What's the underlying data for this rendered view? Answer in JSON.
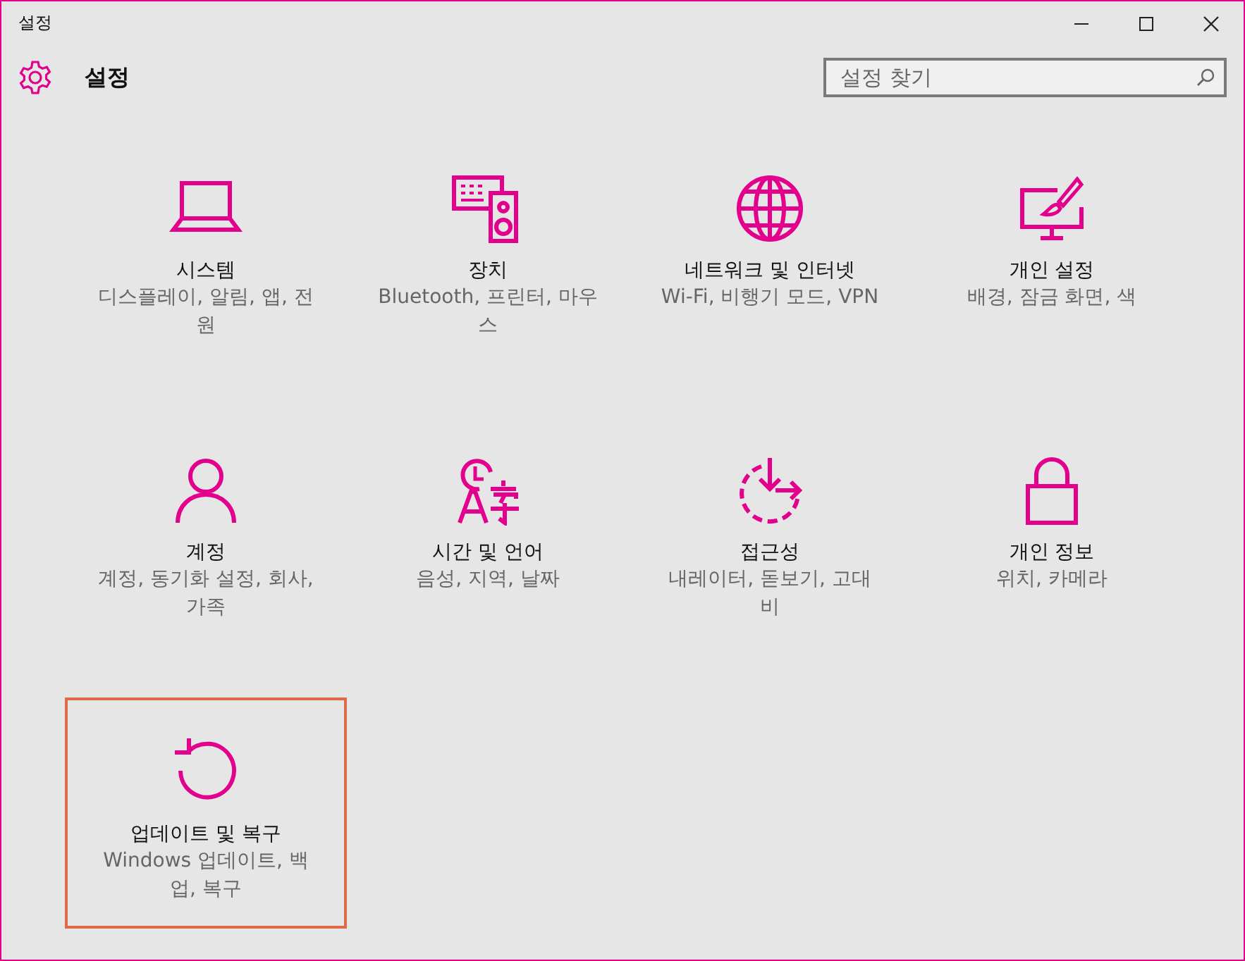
{
  "window": {
    "title": "설정"
  },
  "header": {
    "title": "설정",
    "search": {
      "placeholder": "설정 찾기"
    }
  },
  "tiles": [
    {
      "title": "시스템",
      "description": "디스플레이, 알림, 앱, 전원",
      "selected": false
    },
    {
      "title": "장치",
      "description": "Bluetooth, 프린터, 마우스",
      "selected": false
    },
    {
      "title": "네트워크 및 인터넷",
      "description": "Wi-Fi, 비행기 모드, VPN",
      "selected": false
    },
    {
      "title": "개인 설정",
      "description": "배경, 잠금 화면, 색",
      "selected": false
    },
    {
      "title": "계정",
      "description": "계정, 동기화 설정, 회사, 가족",
      "selected": false
    },
    {
      "title": "시간 및 언어",
      "description": "음성, 지역, 날짜",
      "selected": false
    },
    {
      "title": "접근성",
      "description": "내레이터, 돋보기, 고대비",
      "selected": false
    },
    {
      "title": "개인 정보",
      "description": "위치, 카메라",
      "selected": false
    },
    {
      "title": "업데이트 및 복구",
      "description": "Windows 업데이트, 백업, 복구",
      "selected": true
    }
  ]
}
